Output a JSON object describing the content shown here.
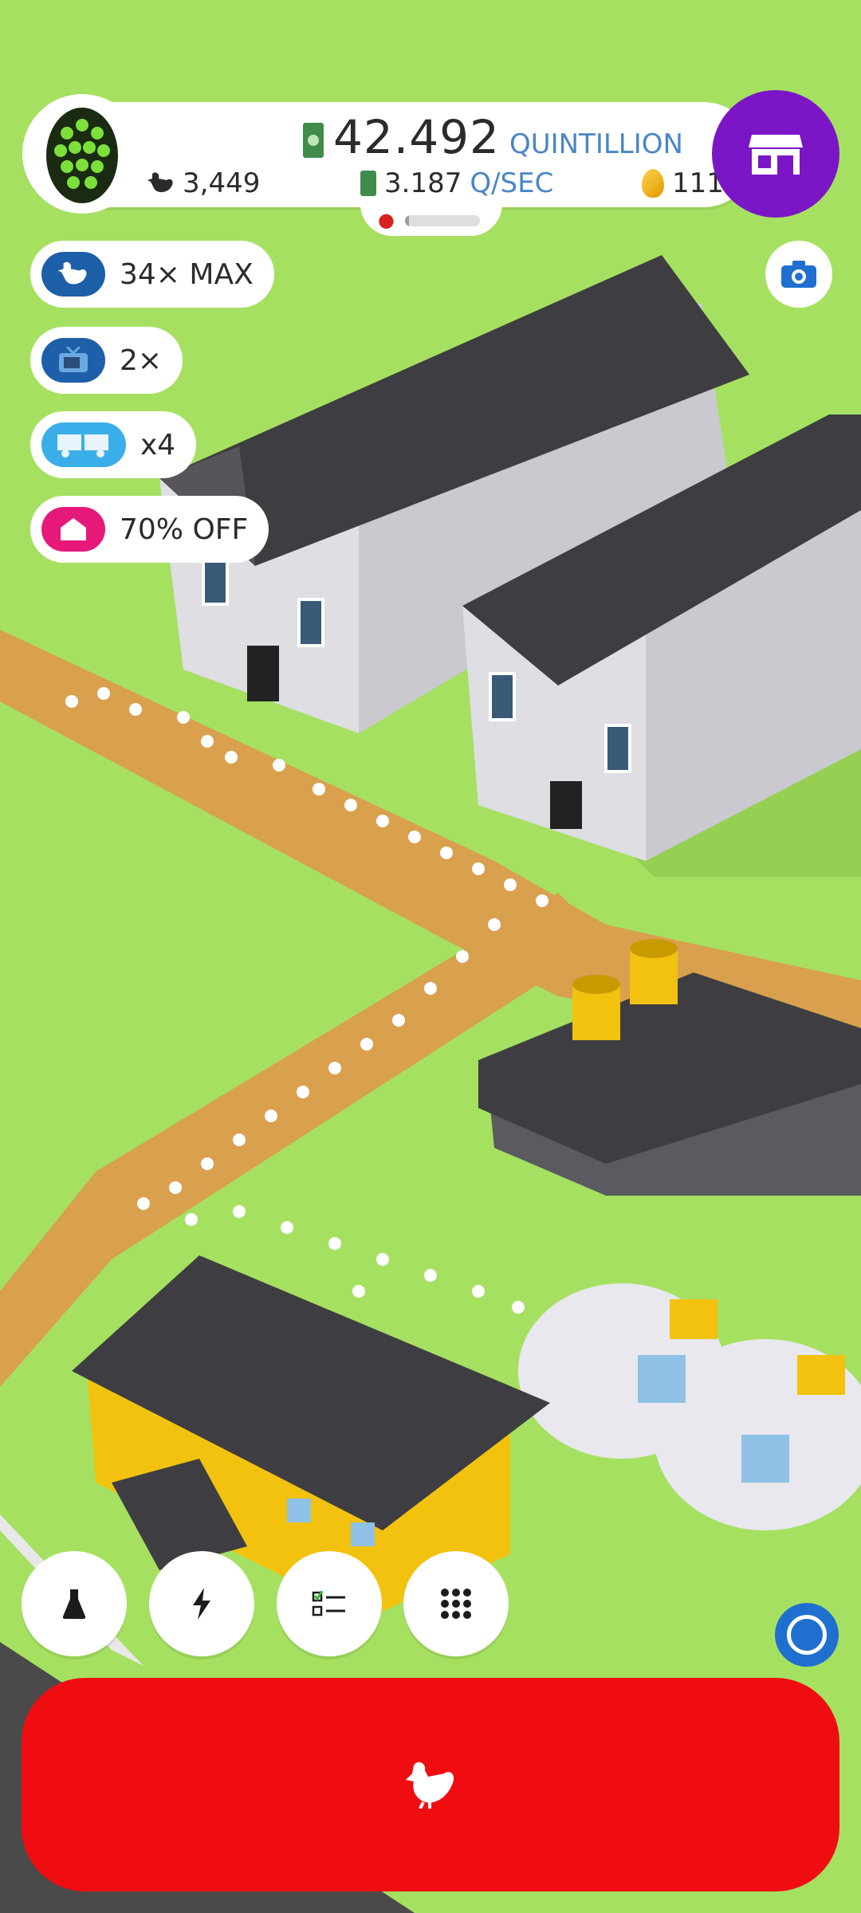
{
  "colors": {
    "grass": "#a6e061",
    "path": "#d9a04e",
    "road": "#4a4a4a",
    "barn_wall": "#c9c9cf",
    "barn_roof": "#3e3e42",
    "coop_yellow": "#f2c20f",
    "shop_purple": "#7b16c6",
    "hatch_red": "#f00d12",
    "accent_blue": "#1f6fd0",
    "boost_pink": "#e6197a",
    "tv_blue": "#1d5fa8",
    "boost_cyan": "#3aaee8"
  },
  "hud": {
    "money_value": "42.492",
    "money_unit": "QUINTILLION",
    "chicken_count": "3,449",
    "rate_value": "3.187",
    "rate_unit": "Q/SEC",
    "egg_count": "111",
    "egg_progress": 0.05,
    "egg_icon": "hex-egg-icon"
  },
  "shop": {
    "icon": "shop-icon"
  },
  "boosts": [
    {
      "label": "34× MAX",
      "icon": "chicken-icon"
    },
    {
      "label": "2×",
      "icon": "tv-icon"
    },
    {
      "label": "x4",
      "icon": "truck-icon"
    },
    {
      "label": "70% OFF",
      "icon": "house-icon"
    }
  ],
  "camera": {
    "icon": "camera-icon"
  },
  "bottom_buttons": [
    {
      "icon": "flask-icon"
    },
    {
      "icon": "lightning-icon"
    },
    {
      "icon": "checklist-icon"
    },
    {
      "icon": "grid-icon"
    }
  ],
  "hatch": {
    "icon": "chicken-icon"
  }
}
